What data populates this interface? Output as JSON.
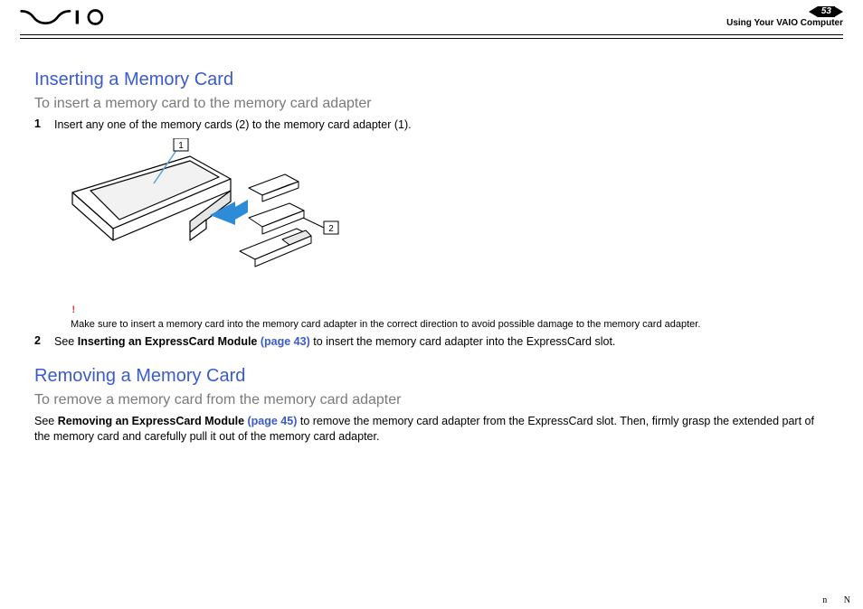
{
  "header": {
    "page_number": "53",
    "section_title": "Using Your VAIO Computer",
    "logo_alt": "VAIO"
  },
  "section1": {
    "heading": "Inserting a Memory Card",
    "subheading": "To insert a memory card to the memory card adapter",
    "step1_num": "1",
    "step1_text": "Insert any one of the memory cards (2) to the memory card adapter (1).",
    "illus_label_1": "1",
    "illus_label_2": "2",
    "note_bang": "!",
    "note_text": "Make sure to insert a memory card into the memory card adapter in the correct direction to avoid possible damage to the memory card adapter.",
    "step2_num": "2",
    "step2_pre": "See ",
    "step2_bold": "Inserting an ExpressCard Module ",
    "step2_link": "(page 43)",
    "step2_post": " to insert the memory card adapter into the ExpressCard slot."
  },
  "section2": {
    "heading": "Removing a Memory Card",
    "subheading": "To remove a memory card from the memory card adapter",
    "para_pre": "See ",
    "para_bold": "Removing an ExpressCard Module ",
    "para_link": "(page 45)",
    "para_post": " to remove the memory card adapter from the ExpressCard slot. Then, firmly grasp the extended part of the memory card and carefully pull it out of the memory card adapter."
  }
}
